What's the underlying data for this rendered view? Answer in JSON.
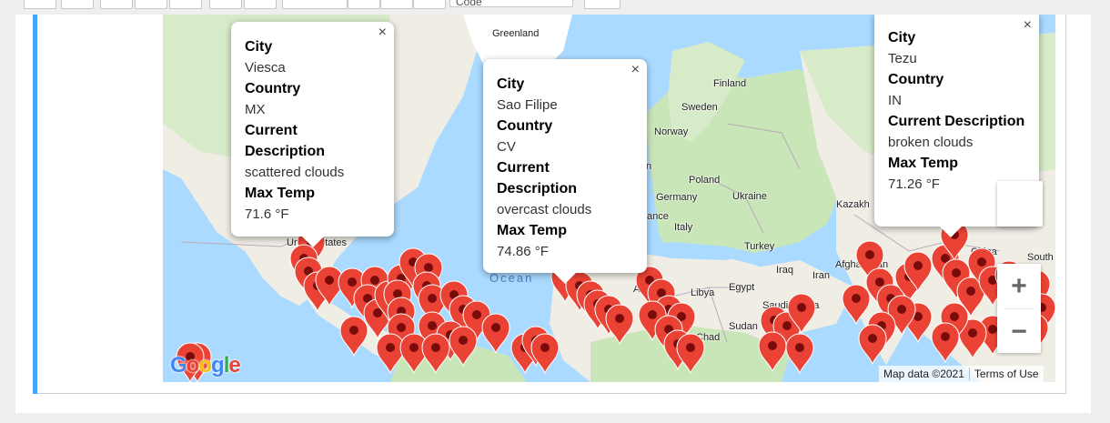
{
  "toolbar": {
    "cell_type_value": "Code"
  },
  "map": {
    "labels": {
      "greenland": "Greenland",
      "finland": "Finland",
      "sweden": "Sweden",
      "norway": "Norway",
      "poland": "Poland",
      "germany": "Germany",
      "ukraine": "Ukraine",
      "kazakhstan": "Kazakh",
      "france": "ance",
      "italy": "Italy",
      "turkey": "Turkey",
      "united_states": "United States",
      "algeria": "Algeria",
      "libya": "Libya",
      "egypt": "Egypt",
      "iraq": "Iraq",
      "iran": "Iran",
      "afghanistan": "Afghanistan",
      "saudi_arabia": "Saudi Arabia",
      "sudan": "Sudan",
      "chad": "Chad",
      "china": "China",
      "south": "South",
      "ocean": "Ocean",
      "n_partial": "n"
    },
    "google_logo": "Google",
    "attribution": "Map data ©2021",
    "terms": "Terms of Use",
    "zoom_in": "+",
    "zoom_out": "−",
    "close_glyph": "×"
  },
  "popups": [
    {
      "city_label": "City",
      "city": "Viesca",
      "country_label": "Country",
      "country": "MX",
      "desc_label": "Current Description",
      "desc": "scattered clouds",
      "temp_label": "Max Temp",
      "temp": "71.6 °F"
    },
    {
      "city_label": "City",
      "city": "Sao Filipe",
      "country_label": "Country",
      "country": "CV",
      "desc_label": "Current Description",
      "desc": "overcast clouds",
      "temp_label": "Max Temp",
      "temp": "74.86 °F"
    },
    {
      "city_label": "City",
      "city": "Tezu",
      "country_label": "Country",
      "country": "IN",
      "desc_label": "Current Description",
      "desc": "broken clouds",
      "temp_label": "Max Temp",
      "temp": "71.26 °F"
    }
  ],
  "colors": {
    "water": "#aadaff",
    "land": "#f0ede5",
    "green_land": "#c9e6b9",
    "marker": "#ea4335",
    "marker_dot": "#7a0b0b",
    "cell_accent": "#42a5f5"
  }
}
